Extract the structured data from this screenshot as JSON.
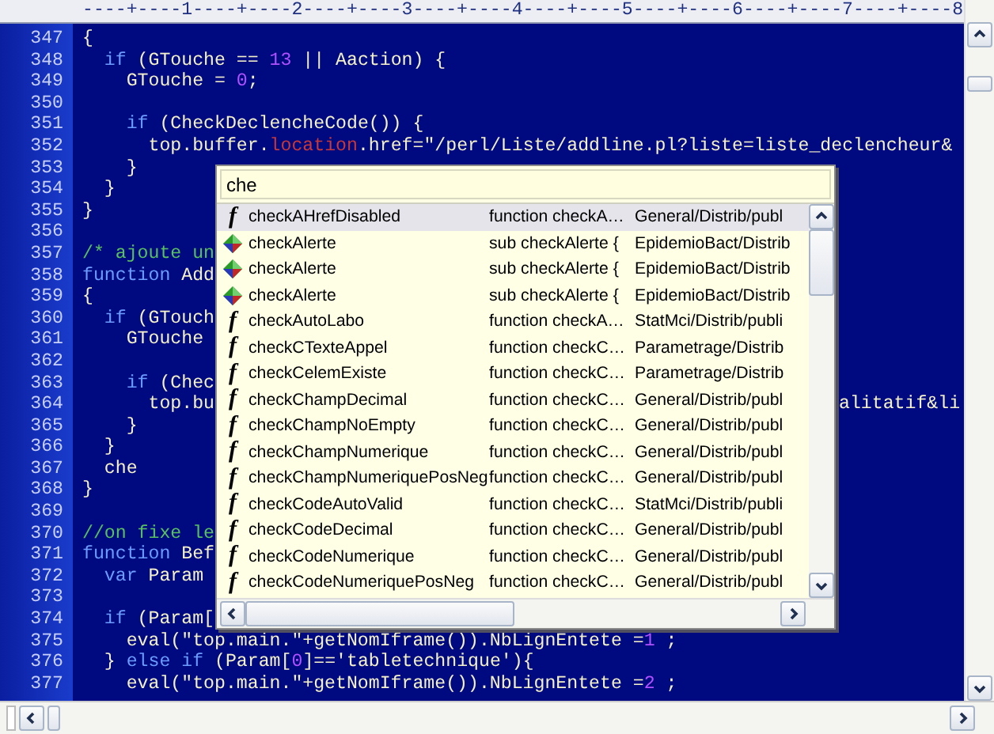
{
  "ruler": {
    "text": "----+----1----+----2----+----3----+----4----+----5----+----6----+----7----+----8"
  },
  "code_lines": [
    {
      "number": "347",
      "tokens": [
        {
          "text": "{",
          "kind": "plain"
        }
      ]
    },
    {
      "number": "348",
      "tokens": [
        {
          "text": "  if",
          "kind": "keyword"
        },
        {
          "text": " (GTouche == ",
          "kind": "plain"
        },
        {
          "text": "13",
          "kind": "number"
        },
        {
          "text": " || Aaction) {",
          "kind": "plain"
        }
      ]
    },
    {
      "number": "349",
      "tokens": [
        {
          "text": "    GTouche = ",
          "kind": "plain"
        },
        {
          "text": "0",
          "kind": "number"
        },
        {
          "text": ";",
          "kind": "plain"
        }
      ]
    },
    {
      "number": "350"
    },
    {
      "number": "351",
      "tokens": [
        {
          "text": "    if",
          "kind": "keyword"
        },
        {
          "text": " (CheckDeclencheCode()) {",
          "kind": "plain"
        }
      ]
    },
    {
      "number": "352",
      "tokens": [
        {
          "text": "      top.buffer.",
          "kind": "plain"
        },
        {
          "text": "location",
          "kind": "property"
        },
        {
          "text": ".href=\"/perl/Liste/addline.pl?liste=liste_declencheur&",
          "kind": "plain"
        }
      ]
    },
    {
      "number": "353",
      "tokens": [
        {
          "text": "    }",
          "kind": "plain"
        }
      ]
    },
    {
      "number": "354",
      "tokens": [
        {
          "text": "  }",
          "kind": "plain"
        }
      ]
    },
    {
      "number": "355",
      "tokens": [
        {
          "text": "}",
          "kind": "plain"
        }
      ]
    },
    {
      "number": "356"
    },
    {
      "number": "357",
      "tokens": [
        {
          "text": "/* ajoute un",
          "kind": "comment"
        }
      ]
    },
    {
      "number": "358",
      "tokens": [
        {
          "text": "function",
          "kind": "keyword"
        },
        {
          "text": " Add",
          "kind": "plain"
        }
      ]
    },
    {
      "number": "359",
      "tokens": [
        {
          "text": "{",
          "kind": "plain"
        }
      ]
    },
    {
      "number": "360",
      "tokens": [
        {
          "text": "  if",
          "kind": "keyword"
        },
        {
          "text": " (GTouch",
          "kind": "plain"
        }
      ]
    },
    {
      "number": "361",
      "tokens": [
        {
          "text": "    GTouche",
          "kind": "plain"
        }
      ]
    },
    {
      "number": "362"
    },
    {
      "number": "363",
      "tokens": [
        {
          "text": "    if",
          "kind": "keyword"
        },
        {
          "text": " (Chec",
          "kind": "plain"
        }
      ]
    },
    {
      "number": "364",
      "tokens": [
        {
          "text": "      top.bu",
          "kind": "plain"
        }
      ],
      "right": "alitatif&li"
    },
    {
      "number": "365",
      "tokens": [
        {
          "text": "    }",
          "kind": "plain"
        }
      ]
    },
    {
      "number": "366",
      "tokens": [
        {
          "text": "  }",
          "kind": "plain"
        }
      ]
    },
    {
      "number": "367",
      "tokens": [
        {
          "text": "  che",
          "kind": "plain"
        }
      ]
    },
    {
      "number": "368",
      "tokens": [
        {
          "text": "}",
          "kind": "plain"
        }
      ]
    },
    {
      "number": "369"
    },
    {
      "number": "370",
      "tokens": [
        {
          "text": "//on fixe le",
          "kind": "comment"
        }
      ]
    },
    {
      "number": "371",
      "tokens": [
        {
          "text": "function",
          "kind": "keyword"
        },
        {
          "text": " Bef",
          "kind": "plain"
        }
      ]
    },
    {
      "number": "372",
      "tokens": [
        {
          "text": "  var",
          "kind": "keyword"
        },
        {
          "text": " Param",
          "kind": "plain"
        }
      ]
    },
    {
      "number": "373"
    },
    {
      "number": "374",
      "tokens": [
        {
          "text": "  if",
          "kind": "keyword"
        },
        {
          "text": " (Param[",
          "kind": "plain"
        }
      ]
    },
    {
      "number": "375",
      "tokens": [
        {
          "text": "    eval(\"top.main.\"+getNomIframe()).NbLignEntete =",
          "kind": "plain"
        },
        {
          "text": "1",
          "kind": "number"
        },
        {
          "text": " ;",
          "kind": "plain"
        }
      ]
    },
    {
      "number": "376",
      "tokens": [
        {
          "text": "  } ",
          "kind": "plain"
        },
        {
          "text": "else if",
          "kind": "keyword"
        },
        {
          "text": " (Param[",
          "kind": "plain"
        },
        {
          "text": "0",
          "kind": "number"
        },
        {
          "text": "]=='tabletechnique'){",
          "kind": "plain"
        }
      ]
    },
    {
      "number": "377",
      "tokens": [
        {
          "text": "    eval(\"top.main.\"+getNomIframe()).NbLignEntete =",
          "kind": "plain"
        },
        {
          "text": "2",
          "kind": "number"
        },
        {
          "text": " ;",
          "kind": "plain"
        }
      ]
    }
  ],
  "completion": {
    "search": {
      "value": "che"
    },
    "items": [
      {
        "kind": "function",
        "icon": "f",
        "name": "checkAHrefDisabled",
        "definition": "function checkA…",
        "path": "General/Distrib/publ",
        "selected": true
      },
      {
        "kind": "sub",
        "name": "checkAlerte",
        "definition": "sub checkAlerte {",
        "path": "EpidemioBact/Distrib",
        "selected": false
      },
      {
        "kind": "sub",
        "name": "checkAlerte",
        "definition": "sub checkAlerte {",
        "path": "EpidemioBact/Distrib",
        "selected": false
      },
      {
        "kind": "sub",
        "name": "checkAlerte",
        "definition": "sub checkAlerte {",
        "path": "EpidemioBact/Distrib",
        "selected": false
      },
      {
        "kind": "function",
        "icon": "f",
        "name": "checkAutoLabo",
        "definition": "function checkA…",
        "path": "StatMci/Distrib/publi",
        "selected": false
      },
      {
        "kind": "function",
        "icon": "f",
        "name": "checkCTexteAppel",
        "definition": "function checkC…",
        "path": "Parametrage/Distrib",
        "selected": false
      },
      {
        "kind": "function",
        "icon": "f",
        "name": "checkCelemExiste",
        "definition": "function checkC…",
        "path": "Parametrage/Distrib",
        "selected": false
      },
      {
        "kind": "function",
        "icon": "f",
        "name": "checkChampDecimal",
        "definition": "function checkC…",
        "path": "General/Distrib/publ",
        "selected": false
      },
      {
        "kind": "function",
        "icon": "f",
        "name": "checkChampNoEmpty",
        "definition": "function checkC…",
        "path": "General/Distrib/publ",
        "selected": false
      },
      {
        "kind": "function",
        "icon": "f",
        "name": "checkChampNumerique",
        "definition": "function checkC…",
        "path": "General/Distrib/publ",
        "selected": false
      },
      {
        "kind": "function",
        "icon": "f",
        "name": "checkChampNumeriquePosNeg",
        "definition": "function checkC…",
        "path": "General/Distrib/publ",
        "selected": false
      },
      {
        "kind": "function",
        "icon": "f",
        "name": "checkCodeAutoValid",
        "definition": "function checkC…",
        "path": "StatMci/Distrib/publi",
        "selected": false
      },
      {
        "kind": "function",
        "icon": "f",
        "name": "checkCodeDecimal",
        "definition": "function checkC…",
        "path": "General/Distrib/publ",
        "selected": false
      },
      {
        "kind": "function",
        "icon": "f",
        "name": "checkCodeNumerique",
        "definition": "function checkC…",
        "path": "General/Distrib/publ",
        "selected": false
      },
      {
        "kind": "function",
        "icon": "f",
        "name": "checkCodeNumeriquePosNeg",
        "definition": "function checkC…",
        "path": "General/Distrib/publ",
        "selected": false
      }
    ]
  }
}
